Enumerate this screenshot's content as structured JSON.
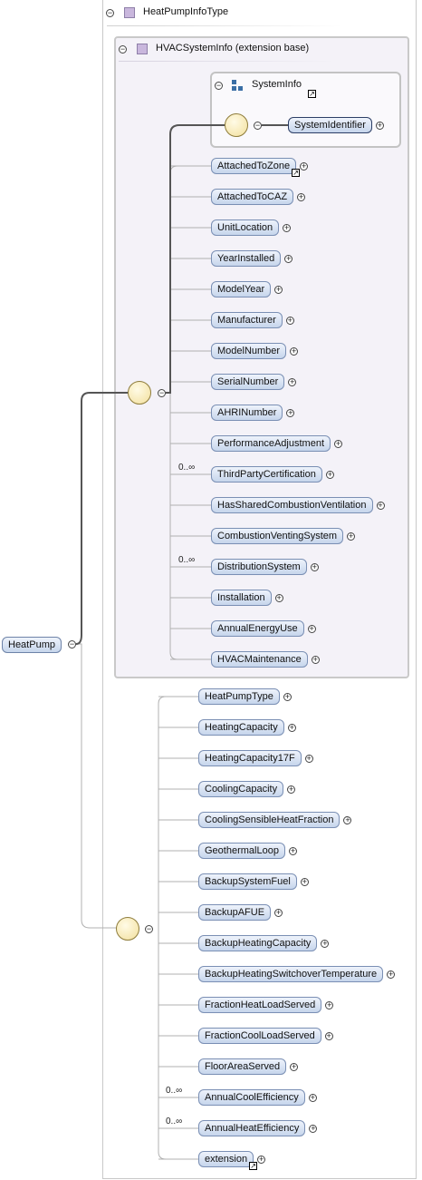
{
  "diagram": {
    "complex_type_title": "HeatPumpInfoType",
    "base_title": "HVACSystemInfo (extension base)",
    "group_title": "SystemInfo",
    "root_element": "HeatPump",
    "group_children": [
      {
        "label": "SystemIdentifier",
        "occurrence": ""
      }
    ],
    "base_children": [
      {
        "label": "AttachedToZone",
        "occurrence": "",
        "ref": true
      },
      {
        "label": "AttachedToCAZ",
        "occurrence": ""
      },
      {
        "label": "UnitLocation",
        "occurrence": ""
      },
      {
        "label": "YearInstalled",
        "occurrence": ""
      },
      {
        "label": "ModelYear",
        "occurrence": ""
      },
      {
        "label": "Manufacturer",
        "occurrence": ""
      },
      {
        "label": "ModelNumber",
        "occurrence": ""
      },
      {
        "label": "SerialNumber",
        "occurrence": ""
      },
      {
        "label": "AHRINumber",
        "occurrence": ""
      },
      {
        "label": "PerformanceAdjustment",
        "occurrence": ""
      },
      {
        "label": "ThirdPartyCertification",
        "occurrence": "0..∞"
      },
      {
        "label": "HasSharedCombustionVentilation",
        "occurrence": ""
      },
      {
        "label": "CombustionVentingSystem",
        "occurrence": ""
      },
      {
        "label": "DistributionSystem",
        "occurrence": "0..∞"
      },
      {
        "label": "Installation",
        "occurrence": ""
      },
      {
        "label": "AnnualEnergyUse",
        "occurrence": ""
      },
      {
        "label": "HVACMaintenance",
        "occurrence": ""
      }
    ],
    "heatpump_children": [
      {
        "label": "HeatPumpType",
        "occurrence": ""
      },
      {
        "label": "HeatingCapacity",
        "occurrence": ""
      },
      {
        "label": "HeatingCapacity17F",
        "occurrence": ""
      },
      {
        "label": "CoolingCapacity",
        "occurrence": ""
      },
      {
        "label": "CoolingSensibleHeatFraction",
        "occurrence": ""
      },
      {
        "label": "GeothermalLoop",
        "occurrence": ""
      },
      {
        "label": "BackupSystemFuel",
        "occurrence": ""
      },
      {
        "label": "BackupAFUE",
        "occurrence": ""
      },
      {
        "label": "BackupHeatingCapacity",
        "occurrence": ""
      },
      {
        "label": "BackupHeatingSwitchoverTemperature",
        "occurrence": ""
      },
      {
        "label": "FractionHeatLoadServed",
        "occurrence": ""
      },
      {
        "label": "FractionCoolLoadServed",
        "occurrence": ""
      },
      {
        "label": "FloorAreaServed",
        "occurrence": ""
      },
      {
        "label": "AnnualCoolEfficiency",
        "occurrence": "0..∞"
      },
      {
        "label": "AnnualHeatEfficiency",
        "occurrence": "0..∞"
      },
      {
        "label": "extension",
        "occurrence": "",
        "ref": true
      }
    ],
    "icons": {
      "type_icon": "complex-type-icon",
      "group_icon": "model-group-icon",
      "sequence_icon": "sequence-compositor-icon",
      "collapse_icon": "collapse-minus-icon",
      "expand_icon": "expand-plus-icon",
      "ref_icon": "reference-arrow-icon"
    },
    "colors": {
      "node_fill_top": "#eef3fb",
      "node_fill_bottom": "#c6d5ec",
      "node_border": "#7a8fb4",
      "base_box_fill": "#f4f2f8",
      "sequence_fill": "#f2df9c",
      "wire": "#555555",
      "connector": "#b0b0b0"
    }
  }
}
